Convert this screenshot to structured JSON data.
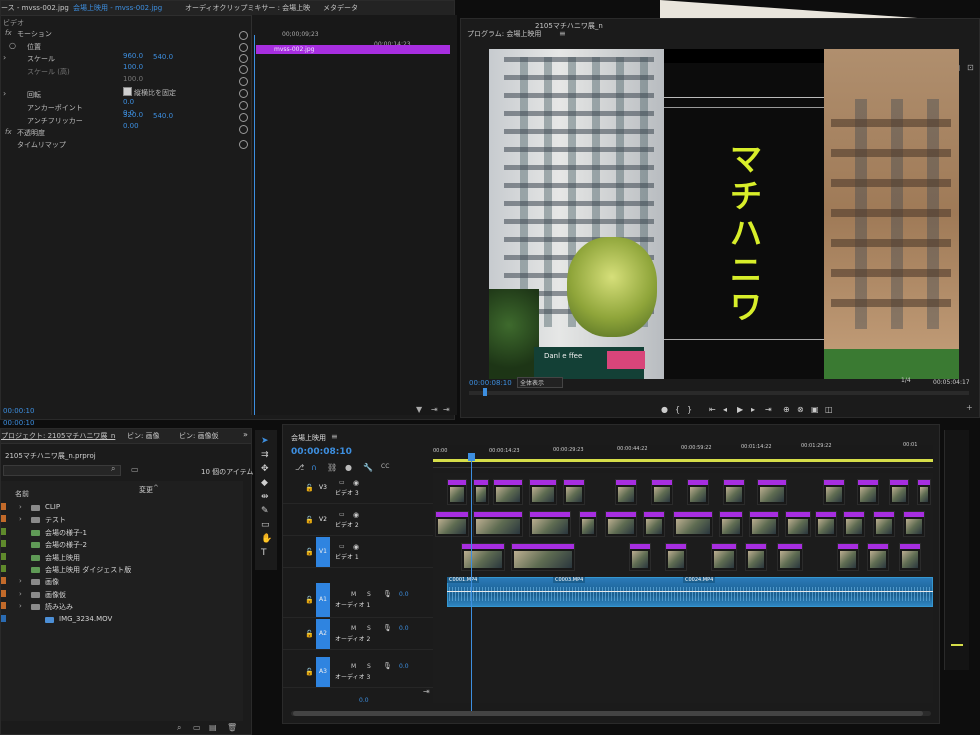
{
  "effect_controls": {
    "tabs": [
      "ース - mvss-002.jpg",
      "会場上映用 - mvss-002.jpg",
      "オーディオクリップミキサー : 会場上映",
      "メタデータ"
    ],
    "section_label": "ビデオ",
    "clip_label": "mvss-002.jpg",
    "timecodes": [
      "00;00;09;23",
      "00;00;14;23"
    ],
    "current_time": "00:00:10",
    "motion": {
      "heading": "モーション",
      "position": {
        "label": "位置",
        "x": "",
        "y": ""
      },
      "scale": {
        "label": "スケール",
        "x": "960.0",
        "y": "540.0"
      },
      "scale_height": {
        "label": "スケール (高)",
        "value": "100.0"
      },
      "scale_width": {
        "label": "",
        "value": "100.0"
      },
      "uniform_scale": {
        "label": "縦横比を固定",
        "checked": true
      },
      "rotation": {
        "label": "回転",
        "value": "0.0"
      },
      "anchor": {
        "label": "アンカーポイント",
        "value": "0.0"
      },
      "anti_flicker": {
        "label": "アンチフリッカー",
        "x": "320.0",
        "y": "540.0"
      },
      "anti_flicker_value": "0.00"
    },
    "opacity": {
      "label": "不透明度"
    },
    "time_remap": {
      "label": "タイムリマップ"
    }
  },
  "program_monitor": {
    "title": "プログラム: 会場上映用",
    "sequence_title": "2105マチハニワ展_n",
    "overlay_text": "マチハニワ",
    "storefront_sign": "Danl e ffee",
    "timecode_current": "00:00:08:10",
    "zoom_select": "全体表示",
    "resolution": "1/4",
    "timecode_total": "00:05:04:17"
  },
  "project": {
    "tabs": [
      "プロジェクト: 2105マチハニワ展_n",
      "ビン: 画像",
      "ビン: 画像仮"
    ],
    "file_name": "2105マチハニワ展_n.prproj",
    "item_count": "10 個のアイテム",
    "columns": {
      "name": "名前",
      "modified": "変更"
    },
    "items": [
      {
        "label": "CLIP",
        "color": "#c26a2a",
        "type": "folder"
      },
      {
        "label": "テスト",
        "color": "#c26a2a",
        "type": "folder"
      },
      {
        "label": "会場の様子-1",
        "color": "#5f8a2c",
        "type": "sequence"
      },
      {
        "label": "会場の様子-2",
        "color": "#5f8a2c",
        "type": "sequence"
      },
      {
        "label": "会場上映用",
        "color": "#5f8a2c",
        "type": "sequence"
      },
      {
        "label": "会場上映用 ダイジェスト版",
        "color": "#5f8a2c",
        "type": "sequence"
      },
      {
        "label": "画像",
        "color": "#c26a2a",
        "type": "folder"
      },
      {
        "label": "画像仮",
        "color": "#c26a2a",
        "type": "folder"
      },
      {
        "label": "読み込み",
        "color": "#c26a2a",
        "type": "folder"
      },
      {
        "label": "IMG_3234.MOV",
        "color": "#2a6bb2",
        "type": "clip"
      }
    ],
    "current_time": "00:00:10"
  },
  "timeline": {
    "tab_label": "会場上映用",
    "timecode": "00:00:08:10",
    "ruler": [
      "00:00",
      "00:00:14:23",
      "00:00:29:23",
      "00:00:44:22",
      "00:00:59:22",
      "00:01:14:22",
      "00:01:29:22",
      "00:01"
    ],
    "tracks": [
      {
        "id": "V3",
        "name": "ビデオ 3"
      },
      {
        "id": "V2",
        "name": "ビデオ 2"
      },
      {
        "id": "V1",
        "name": "ビデオ 1"
      },
      {
        "id": "A1",
        "name": "オーディオ 1",
        "level": "0.0"
      },
      {
        "id": "A2",
        "name": "オーディオ 2",
        "level": "0.0"
      },
      {
        "id": "A3",
        "name": "オーディオ 3",
        "level": "0.0"
      }
    ],
    "master_level": "0.0",
    "audio_clips": [
      "C0001.MP4",
      "C0003.MP4",
      "C0024.MP4"
    ],
    "cc_label": "CC",
    "track_toggles": [
      "M",
      "S"
    ]
  },
  "colors": {
    "accent_blue": "#2f84e0",
    "clip_purple": "#a72ee0",
    "audio_blue": "#1f6fa6",
    "overlay_yellow": "#d8ee2a"
  }
}
